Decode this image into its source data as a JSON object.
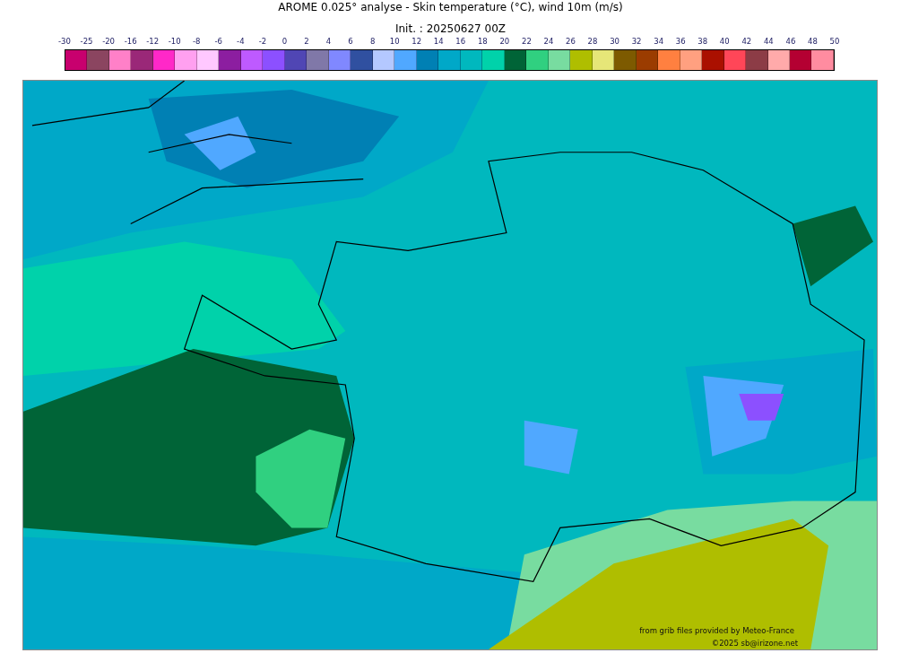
{
  "title": "AROME 0.025° analyse - Skin temperature (°C), wind 10m (m/s)",
  "subtitle": "Init. : 20250627 00Z",
  "colorbar": {
    "ticks": [
      "-30",
      "-25",
      "-20",
      "-16",
      "-12",
      "-10",
      "-8",
      "-6",
      "-4",
      "-2",
      "0",
      "2",
      "4",
      "6",
      "8",
      "10",
      "12",
      "14",
      "16",
      "18",
      "20",
      "22",
      "24",
      "26",
      "28",
      "30",
      "32",
      "34",
      "36",
      "38",
      "40",
      "42",
      "44",
      "46",
      "48",
      "50"
    ],
    "bins": [
      {
        "color": "#c8006e"
      },
      {
        "color": "#8b4560"
      },
      {
        "color": "#ff80c8"
      },
      {
        "color": "#9a2878"
      },
      {
        "color": "#ff28c8"
      },
      {
        "color": "#ffa0f0"
      },
      {
        "color": "#ffc8ff"
      },
      {
        "color": "#8c1ea0"
      },
      {
        "color": "#be5aff"
      },
      {
        "color": "#8c50ff"
      },
      {
        "color": "#5046b4"
      },
      {
        "color": "#8078a8"
      },
      {
        "color": "#8088ff"
      },
      {
        "color": "#3050a0"
      },
      {
        "color": "#b4c8ff"
      },
      {
        "color": "#50a8ff"
      },
      {
        "color": "#0080b4"
      },
      {
        "color": "#00a8c8"
      },
      {
        "color": "#00b8be"
      },
      {
        "color": "#00d2aa"
      },
      {
        "color": "#006437"
      },
      {
        "color": "#30d080"
      },
      {
        "color": "#78dca0"
      },
      {
        "color": "#afbe00"
      },
      {
        "color": "#e6e678"
      },
      {
        "color": "#7d5a00"
      },
      {
        "color": "#9b3c00"
      },
      {
        "color": "#ff8040"
      },
      {
        "color": "#ffa080"
      },
      {
        "color": "#aa1000"
      },
      {
        "color": "#ff4658"
      },
      {
        "color": "#8c3c46"
      },
      {
        "color": "#ffaaaa"
      },
      {
        "color": "#b40032"
      },
      {
        "color": "#ff8ca0"
      }
    ]
  },
  "map": {
    "credits": [
      "from grib files provided by Meteo-France",
      "©2025 sb@irizone.net"
    ]
  }
}
